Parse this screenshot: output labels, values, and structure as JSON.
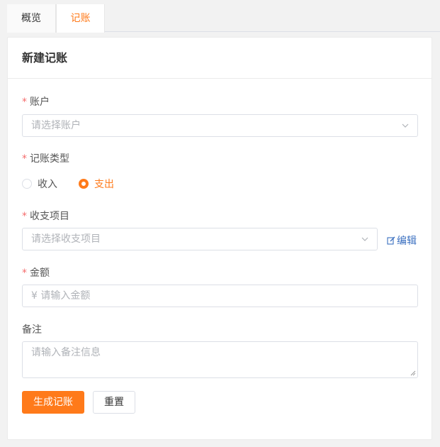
{
  "tabs": [
    {
      "label": "概览"
    },
    {
      "label": "记账"
    }
  ],
  "card": {
    "title": "新建记账"
  },
  "form": {
    "account": {
      "label": "账户",
      "placeholder": "请选择账户"
    },
    "type": {
      "label": "记账类型",
      "options": [
        {
          "label": "收入",
          "selected": false
        },
        {
          "label": "支出",
          "selected": true
        }
      ]
    },
    "item": {
      "label": "收支项目",
      "placeholder": "请选择收支项目",
      "edit_label": "编辑"
    },
    "amount": {
      "label": "金额",
      "placeholder": "¥ 请输入金额"
    },
    "note": {
      "label": "备注",
      "placeholder": "请输入备注信息"
    }
  },
  "buttons": {
    "submit": "生成记账",
    "reset": "重置"
  },
  "colors": {
    "accent": "#ff7a1a",
    "required": "#f56c6c",
    "link": "#3a6fc0"
  }
}
